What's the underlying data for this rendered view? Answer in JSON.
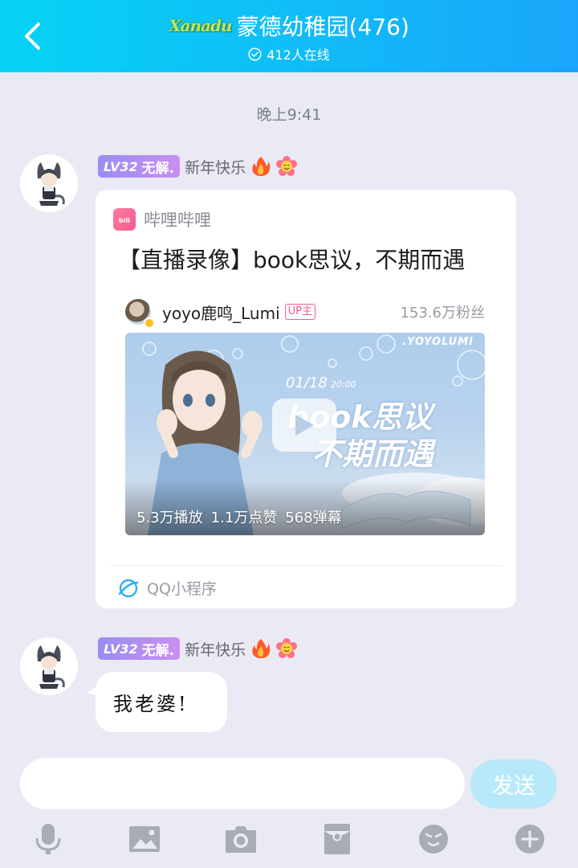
{
  "header": {
    "logo_text": "Xanadu",
    "title": "蒙德幼稚园(476)",
    "online": "412人在线"
  },
  "timestamp": "晚上9:41",
  "messages": [
    {
      "sender": {
        "level": "LV32",
        "title_badge": "无解.",
        "name": "新年快乐"
      },
      "card": {
        "source": "哔哩哔哩",
        "title": "【直播录像】book思议，不期而遇",
        "uploader": "yoyo鹿鸣_Lumi",
        "uploader_tag": "UP主",
        "fans": "153.6万粉丝",
        "thumbnail": {
          "brand": ".YOYOLUMI",
          "date": "01/18",
          "time": "20:00",
          "headline_line1": "book思议",
          "headline_line2": "不期而遇"
        },
        "stats": {
          "plays": "5.3万播放",
          "likes": "1.1万点赞",
          "danmaku": "568弹幕"
        },
        "footer": "QQ小程序"
      }
    },
    {
      "sender": {
        "level": "LV32",
        "title_badge": "无解.",
        "name": "新年快乐"
      },
      "text": "我老婆!"
    }
  ],
  "input": {
    "placeholder": "",
    "send_label": "发送"
  },
  "colors": {
    "header_start": "#06d3f5",
    "header_end": "#1aa5fa",
    "background": "#e9eaf4",
    "send_button": "#b7e9fb",
    "bilibili_pink": "#f25d8e",
    "icon_gray": "#a9abb6"
  },
  "toolbar_icons": [
    "microphone-icon",
    "image-icon",
    "camera-icon",
    "red-packet-icon",
    "emoji-icon",
    "plus-icon"
  ]
}
